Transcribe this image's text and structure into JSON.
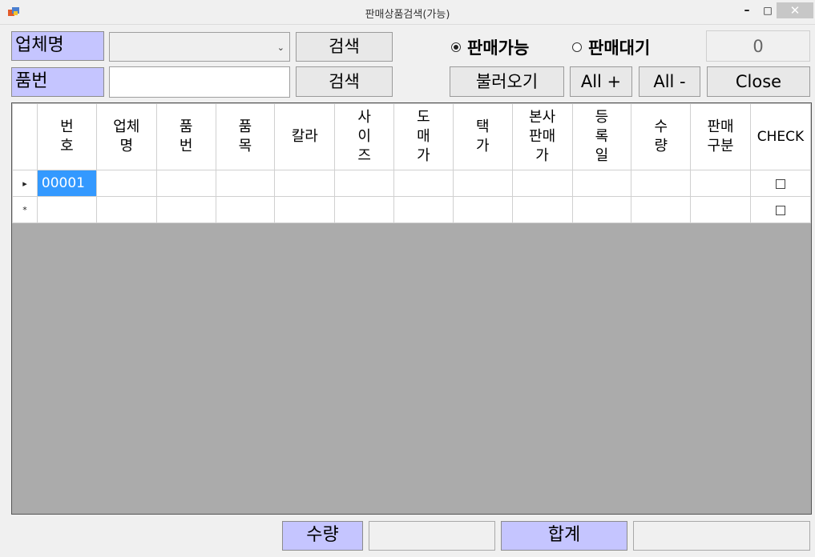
{
  "window": {
    "title": "판매상품검색(가능)",
    "minimize_glyph": "–",
    "maximize_glyph": "□",
    "close_glyph": "✕"
  },
  "filters": {
    "vendor_label": "업체명",
    "vendor_value": "",
    "part_label": "품번",
    "part_value": "",
    "search_label": "검색"
  },
  "mode": {
    "selected": "판매가능",
    "options": [
      "판매가능",
      "판매대기"
    ]
  },
  "actions": {
    "load_label": "불러오기",
    "all_plus_label": "All +",
    "all_minus_label": "All -",
    "close_label": "Close"
  },
  "count_value": "0",
  "grid": {
    "columns": [
      {
        "label": "번\n호"
      },
      {
        "label": "업체\n명"
      },
      {
        "label": "품\n번"
      },
      {
        "label": "품\n목"
      },
      {
        "label": "칼라"
      },
      {
        "label": "사\n이\n즈"
      },
      {
        "label": "도\n매\n가"
      },
      {
        "label": "택\n가"
      },
      {
        "label": "본사\n판매\n가"
      },
      {
        "label": "등\n록\n일"
      },
      {
        "label": "수\n량"
      },
      {
        "label": "판매\n구분"
      },
      {
        "label": "CHECK"
      }
    ],
    "rows": [
      {
        "indicator": "▸",
        "no": "00001",
        "checked": false
      },
      {
        "indicator": "*",
        "no": "",
        "checked": false
      }
    ]
  },
  "footer": {
    "qty_label": "수량",
    "qty_value": "",
    "total_label": "합계",
    "total_value": ""
  },
  "colors": {
    "label_bg": "#c5c5ff",
    "selection": "#3399ff",
    "grid_empty": "#ababab"
  }
}
